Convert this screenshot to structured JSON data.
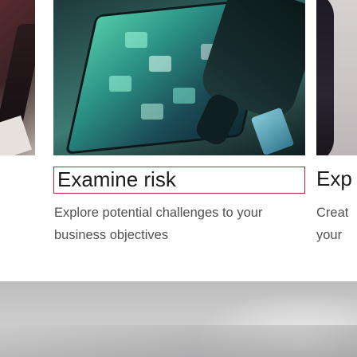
{
  "cards": [
    {
      "title": "Examine risk",
      "description": "Explore potential challenges to your business objectives",
      "image_icon": "tablet-image"
    }
  ],
  "side_card": {
    "title_partial": "Exp",
    "description_lines_partial": [
      "Creat",
      "your"
    ]
  },
  "colors": {
    "focus_outline": "#c0233b",
    "title_text": "#1d1d1f",
    "body_text": "#505054"
  }
}
